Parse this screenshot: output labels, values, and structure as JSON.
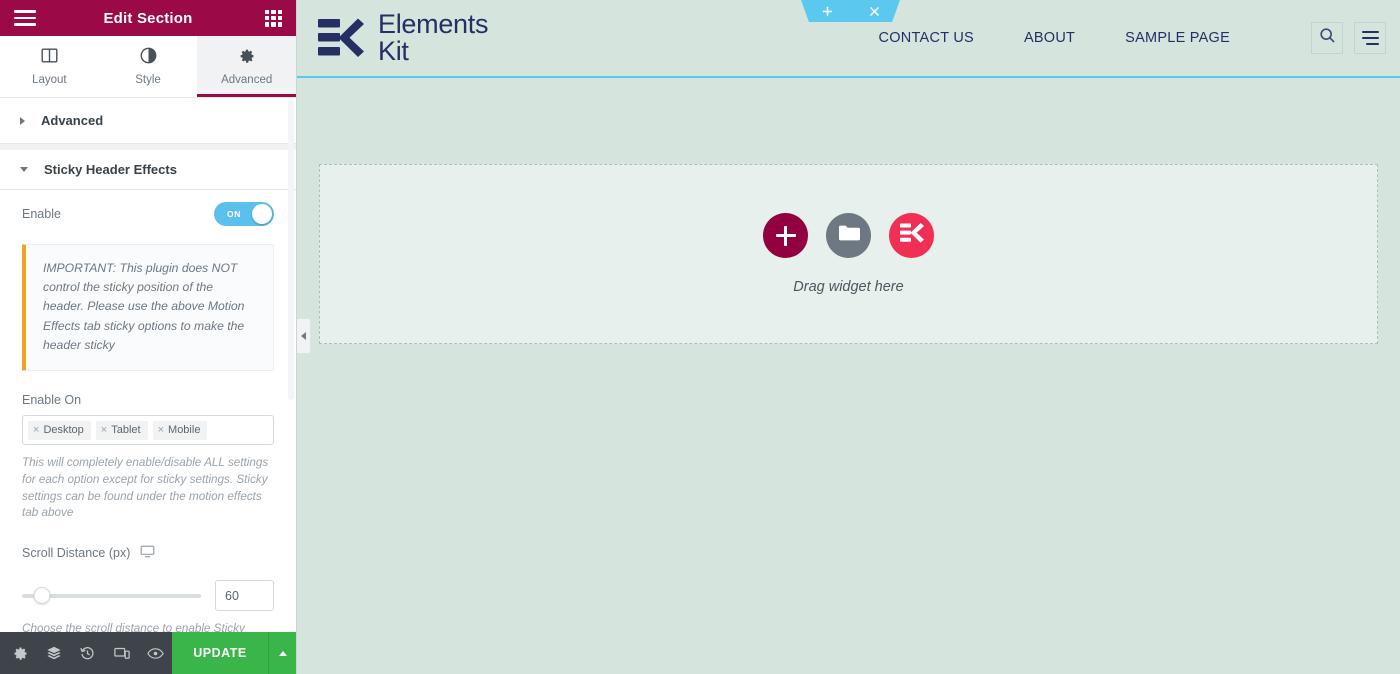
{
  "panel": {
    "header": {
      "title": "Edit Section",
      "menu_icon": "hamburger-menu-icon",
      "grid_icon": "apps-grid-icon"
    },
    "tabs": [
      {
        "label": "Layout",
        "icon": "layout-columns-icon",
        "active": false
      },
      {
        "label": "Style",
        "icon": "contrast-circle-icon",
        "active": false
      },
      {
        "label": "Advanced",
        "icon": "gear-icon",
        "active": true
      }
    ],
    "sections": [
      {
        "title": "Advanced",
        "expanded": false
      },
      {
        "title": "Sticky Header Effects",
        "expanded": true
      }
    ],
    "controls": {
      "enable_label": "Enable",
      "enable_toggle_state": "ON",
      "notice": "IMPORTANT: This plugin does NOT control the sticky position of the header. Please use the above Motion Effects tab sticky options to make the header sticky",
      "enable_on_label": "Enable On",
      "enable_on_tags": [
        "Desktop",
        "Tablet",
        "Mobile"
      ],
      "enable_on_helper": "This will completely enable/disable ALL settings for each option except for sticky settings. Sticky settings can be found under the motion effects tab above",
      "scroll_distance_label": "Scroll Distance (px)",
      "scroll_distance_device_icon": "desktop-monitor-icon",
      "scroll_distance_value": "60",
      "scroll_distance_percent": 11,
      "scroll_distance_helper": "Choose the scroll distance to enable Sticky"
    },
    "footer": {
      "icons": [
        "settings-gear-icon",
        "navigator-layers-icon",
        "history-icon",
        "responsive-mode-icon",
        "preview-eye-icon"
      ],
      "update_label": "UPDATE",
      "update_caret_icon": "caret-up-icon"
    },
    "collapse_icon": "chevron-left-icon"
  },
  "canvas": {
    "section_toolbar": {
      "add_icon": "plus-icon",
      "drag_icon": "drag-handle-dots-icon",
      "close_icon": "close-x-icon"
    },
    "site_header": {
      "logo": {
        "icon": "elements-kit-logo-icon",
        "line1": "Elements",
        "line2": "Kit"
      },
      "nav": [
        {
          "label": "CONTACT US"
        },
        {
          "label": "ABOUT"
        },
        {
          "label": "SAMPLE PAGE"
        }
      ],
      "search_icon": "search-icon",
      "menu_icon": "hamburger-menu-icon"
    },
    "dropzone": {
      "buttons": [
        {
          "name": "add-widget-button",
          "icon": "plus-icon"
        },
        {
          "name": "add-template-button",
          "icon": "folder-icon"
        },
        {
          "name": "elementskit-widget-button",
          "icon": "elements-kit-mark-icon"
        }
      ],
      "label": "Drag widget here"
    }
  },
  "colors": {
    "panel_header": "#9b0a46",
    "accent_blue": "#5bc8ef",
    "update_green": "#39b54a",
    "canvas_bg": "#d5e5de",
    "logo_navy": "#252f63",
    "ek_pink": "#f02f55",
    "notice_bar": "#f0a322"
  }
}
